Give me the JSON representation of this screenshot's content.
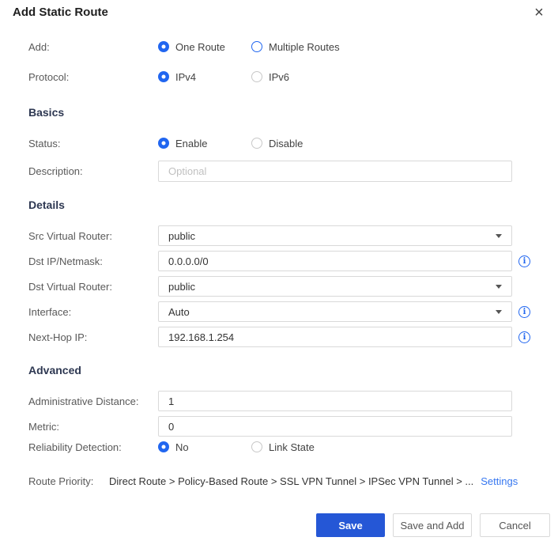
{
  "colors": {
    "accent": "#2166f0",
    "save_button": "#2557d6",
    "link": "#3677f0"
  },
  "icons": {
    "close": "×",
    "info": "i",
    "dropdown_caret": "▾"
  },
  "header": {
    "title": "Add Static Route"
  },
  "sections": {
    "basics": "Basics",
    "details": "Details",
    "advanced": "Advanced"
  },
  "rows": {
    "add": {
      "label": "Add:",
      "option1": "One Route",
      "option2": "Multiple Routes",
      "selected": "One Route"
    },
    "protocol": {
      "label": "Protocol:",
      "option1": "IPv4",
      "option2": "IPv6",
      "selected": "IPv4"
    },
    "status": {
      "label": "Status:",
      "option1": "Enable",
      "option2": "Disable",
      "selected": "Enable"
    },
    "description": {
      "label": "Description:",
      "placeholder": "Optional",
      "value": ""
    },
    "src_virtual_router": {
      "label": "Src Virtual Router:",
      "value": "public"
    },
    "dst_ip_netmask": {
      "label": "Dst IP/Netmask:",
      "value": "0.0.0.0/0"
    },
    "dst_virtual_router": {
      "label": "Dst Virtual Router:",
      "value": "public"
    },
    "interface": {
      "label": "Interface:",
      "value": "Auto"
    },
    "next_hop_ip": {
      "label": "Next-Hop IP:",
      "value": "192.168.1.254"
    },
    "administrative_distance": {
      "label": "Administrative Distance:",
      "value": "1"
    },
    "metric": {
      "label": "Metric:",
      "value": "0"
    },
    "reliability_detection": {
      "label": "Reliability Detection:",
      "option1": "No",
      "option2": "Link State",
      "selected": "No"
    },
    "route_priority": {
      "label": "Route Priority:",
      "value": "Direct Route > Policy-Based Route > SSL VPN Tunnel > IPSec VPN Tunnel > ...",
      "link": "Settings"
    }
  },
  "buttons": {
    "save": "Save",
    "save_and_add": "Save and Add",
    "cancel": "Cancel"
  }
}
